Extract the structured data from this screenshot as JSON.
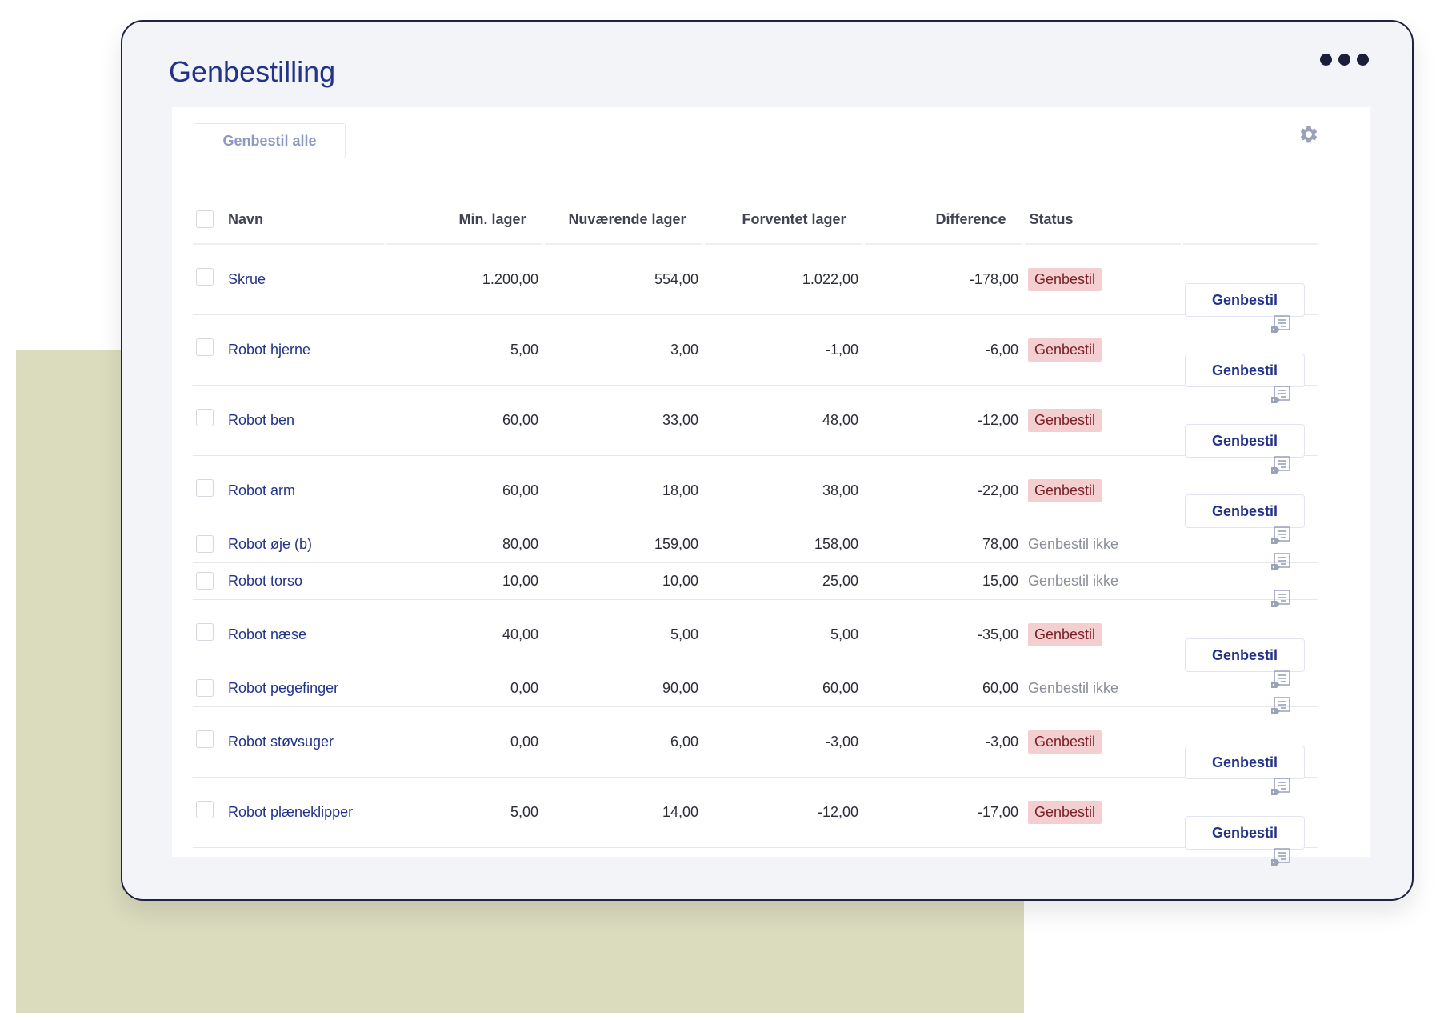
{
  "page": {
    "title": "Genbestilling"
  },
  "toolbar": {
    "reorder_all_label": "Genbestil alle"
  },
  "icons": {
    "menu": "more-dots-icon",
    "settings": "gear-icon",
    "note": "note-tag-icon"
  },
  "colors": {
    "accent": "#23338a",
    "badge_bg": "#f3cfd2",
    "badge_text": "#7a1f25",
    "backdrop": "#dbdcbe",
    "window_border": "#1f2240"
  },
  "table": {
    "columns": [
      "Navn",
      "Min. lager",
      "Nuværende lager",
      "Forventet lager",
      "Difference",
      "Status"
    ],
    "action_label": "Genbestil",
    "rows": [
      {
        "name": "Skrue",
        "min": "1.200,00",
        "current": "554,00",
        "expected": "1.022,00",
        "difference": "-178,00",
        "status": "Genbestil",
        "reorder": true
      },
      {
        "name": "Robot hjerne",
        "min": "5,00",
        "current": "3,00",
        "expected": "-1,00",
        "difference": "-6,00",
        "status": "Genbestil",
        "reorder": true
      },
      {
        "name": "Robot ben",
        "min": "60,00",
        "current": "33,00",
        "expected": "48,00",
        "difference": "-12,00",
        "status": "Genbestil",
        "reorder": true
      },
      {
        "name": "Robot arm",
        "min": "60,00",
        "current": "18,00",
        "expected": "38,00",
        "difference": "-22,00",
        "status": "Genbestil",
        "reorder": true
      },
      {
        "name": "Robot øje (b)",
        "min": "80,00",
        "current": "159,00",
        "expected": "158,00",
        "difference": "78,00",
        "status": "Genbestil ikke",
        "reorder": false
      },
      {
        "name": "Robot torso",
        "min": "10,00",
        "current": "10,00",
        "expected": "25,00",
        "difference": "15,00",
        "status": "Genbestil ikke",
        "reorder": false
      },
      {
        "name": "Robot næse",
        "min": "40,00",
        "current": "5,00",
        "expected": "5,00",
        "difference": "-35,00",
        "status": "Genbestil",
        "reorder": true
      },
      {
        "name": "Robot pegefinger",
        "min": "0,00",
        "current": "90,00",
        "expected": "60,00",
        "difference": "60,00",
        "status": "Genbestil ikke",
        "reorder": false
      },
      {
        "name": "Robot støvsuger",
        "min": "0,00",
        "current": "6,00",
        "expected": "-3,00",
        "difference": "-3,00",
        "status": "Genbestil",
        "reorder": true
      },
      {
        "name": "Robot plæneklipper",
        "min": "5,00",
        "current": "14,00",
        "expected": "-12,00",
        "difference": "-17,00",
        "status": "Genbestil",
        "reorder": true
      }
    ]
  }
}
